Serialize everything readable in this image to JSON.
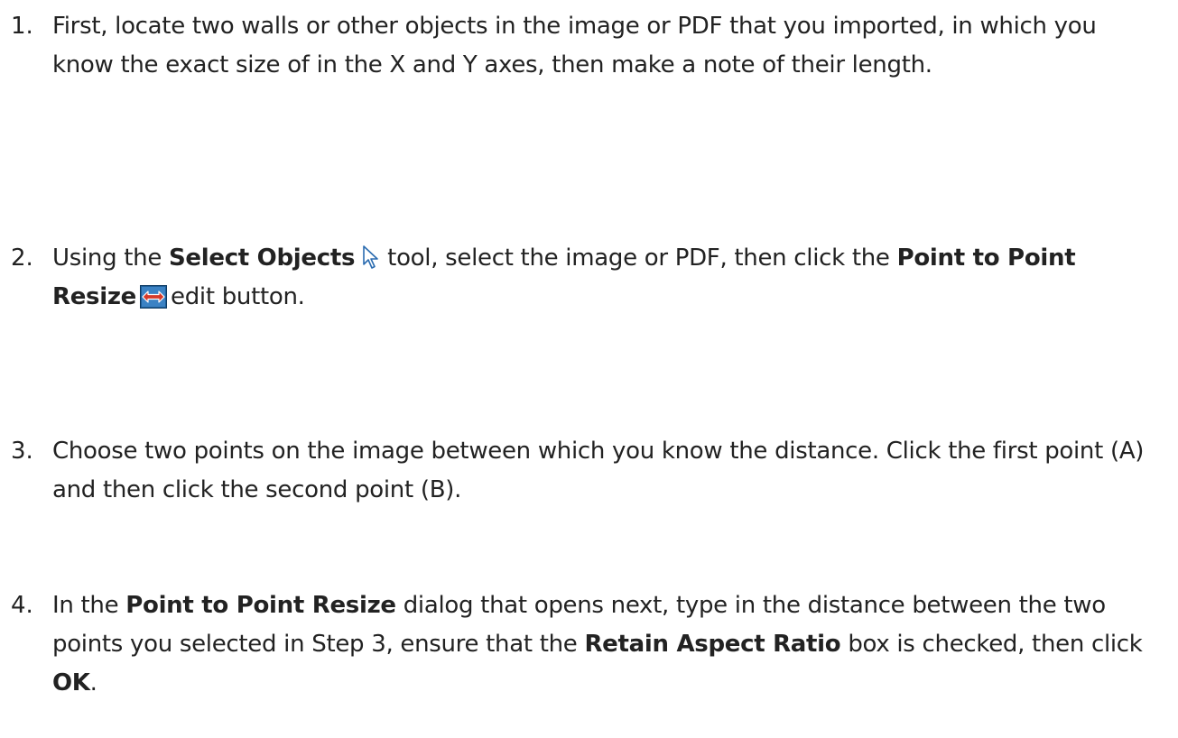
{
  "steps": [
    {
      "number": "1.",
      "parts": [
        {
          "t": "First, locate two walls or other objects in the image or PDF that you imported, in which you know the exact size of in the X and Y axes, then make a note of their length."
        }
      ]
    },
    {
      "number": "2.",
      "parts": [
        {
          "t": "Using the "
        },
        {
          "b": "Select Objects"
        },
        {
          "icon": "select-objects-icon"
        },
        {
          "t": "tool, select the image or PDF, then click the "
        },
        {
          "b": "Point to Point Resize"
        },
        {
          "icon": "point-to-point-resize-icon"
        },
        {
          "t": "edit button."
        }
      ]
    },
    {
      "number": "3.",
      "parts": [
        {
          "t": "Choose two points on the image between which you know the distance. Click the first point (A) and then click the second point (B)."
        }
      ]
    },
    {
      "number": "4.",
      "parts": [
        {
          "t": "In the "
        },
        {
          "b": "Point to Point Resize"
        },
        {
          "t": " dialog that opens next, type in the distance between the two points you selected in Step 3, ensure that the "
        },
        {
          "b": "Retain Aspect Ratio"
        },
        {
          "t": " box is checked, then click "
        },
        {
          "b": "OK"
        },
        {
          "t": "."
        }
      ]
    }
  ],
  "colors": {
    "text": "#222222",
    "icon_blue": "#2b6cb0",
    "icon_red": "#d63a2a"
  }
}
